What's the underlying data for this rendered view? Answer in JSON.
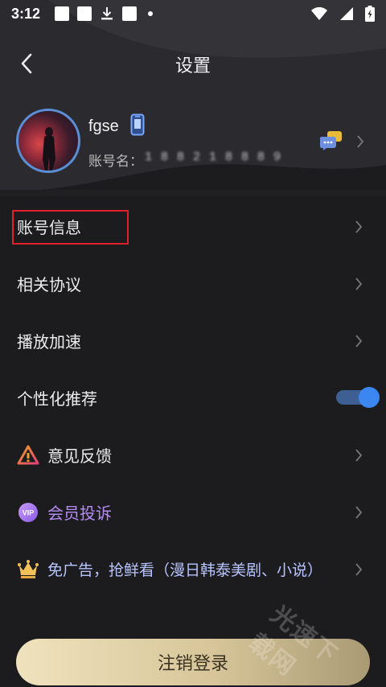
{
  "status_bar": {
    "time": "3:12"
  },
  "header": {
    "title": "设置"
  },
  "profile": {
    "username": "fgse",
    "account_label": "账号名：",
    "account_value": "1 8 8 2 1 8 8 8 9"
  },
  "menu": {
    "items": [
      {
        "label": "账号信息"
      },
      {
        "label": "相关协议"
      },
      {
        "label": "播放加速"
      },
      {
        "label": "个性化推荐",
        "toggle_on": true
      },
      {
        "label": "意见反馈"
      },
      {
        "label": "会员投诉"
      },
      {
        "label": "免广告，抢鲜看（漫日韩泰美剧、小说）"
      }
    ]
  },
  "logout": {
    "label": "注销登录"
  },
  "watermark": {
    "text": "光速下载网"
  },
  "colors": {
    "background": "#1c1c1e",
    "accent_blue": "#3b86f0",
    "vip_purple": "#b58cf4",
    "highlight_red": "#e0202a",
    "logout_gold": "#d8c69a"
  }
}
